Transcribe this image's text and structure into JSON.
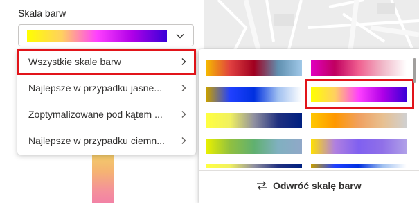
{
  "section": {
    "title": "Skala barw"
  },
  "dropdown": {
    "selected_scale": [
      "#ffff00",
      "#ffd060",
      "#ff40ff",
      "#b000e8",
      "#3a00d8"
    ],
    "chevron_icon": "chevron-down-icon"
  },
  "submenu": {
    "items": [
      {
        "label": "Wszystkie skale barw",
        "selected": true
      },
      {
        "label": "Najlepsze w przypadku jasne..."
      },
      {
        "label": "Zoptymalizowane pod kątem ..."
      },
      {
        "label": "Najlepsze w przypadku ciemn..."
      }
    ],
    "item_icon": "chevron-right-icon"
  },
  "scales": [
    {
      "colors": [
        "#f5b800",
        "#e04040",
        "#a00020",
        "#6090b0",
        "#a0c8e8"
      ]
    },
    {
      "colors": [
        "#e000c0",
        "#c00060",
        "#f06090",
        "#f0b8c8",
        "#ffffff"
      ]
    },
    {
      "colors": [
        "#c8a000",
        "#2040ff",
        "#0030e0",
        "#a0c0f0",
        "#ffffff"
      ]
    },
    {
      "colors": [
        "#ffff00",
        "#ffd060",
        "#ff40ff",
        "#b000e8",
        "#3a00d8"
      ],
      "selected": true
    },
    {
      "colors": [
        "#ffff40",
        "#f0f060",
        "#9090a0",
        "#203080",
        "#002080"
      ]
    },
    {
      "colors": [
        "#ffc800",
        "#ff9800",
        "#f0a060",
        "#e8c090",
        "#d0d0d0"
      ]
    },
    {
      "colors": [
        "#e8f000",
        "#90c040",
        "#60b070",
        "#80b0c0",
        "#90a8c8"
      ]
    },
    {
      "colors": [
        "#ffe000",
        "#b080e0",
        "#8060f0",
        "#9070e8",
        "#b0a0e8"
      ]
    }
  ],
  "reverse": {
    "label": "Odwróć skalę barw",
    "icon": "swap-icon"
  },
  "colors": {
    "accent_red": "#e2141a",
    "border": "#c8c6c4",
    "text": "#323130"
  }
}
